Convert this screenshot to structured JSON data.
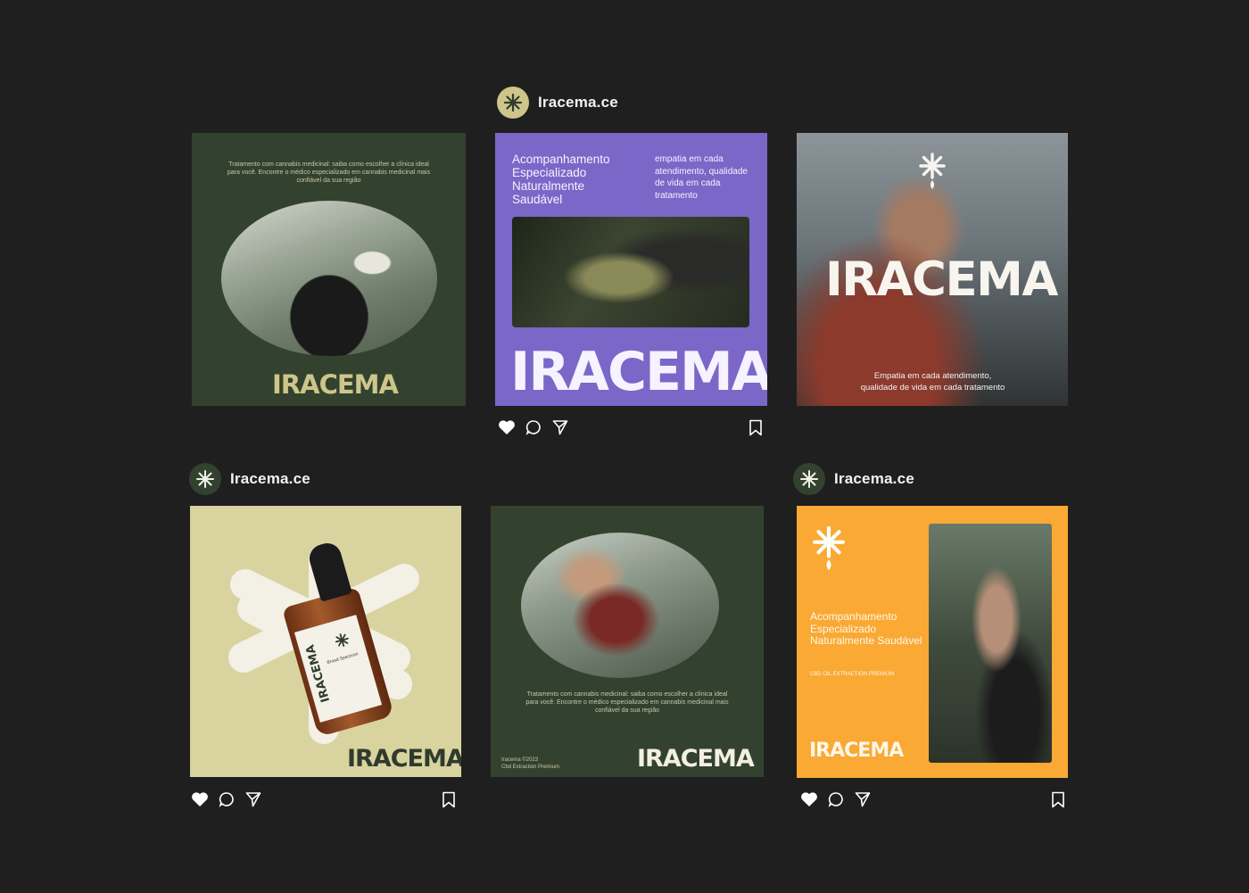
{
  "accounts": {
    "top": {
      "handle": "Iracema.ce"
    },
    "left": {
      "handle": "Iracema.ce"
    },
    "right": {
      "handle": "Iracema.ce"
    }
  },
  "posts": {
    "p1": {
      "caption": "Tratamento com cannabis medicinal: saiba como escolher a clínica ideal para você. Encontre o médico especializado em cannabis medicinal mais confiável da sua região",
      "wordmark": "IRACEMA"
    },
    "p2": {
      "heading": "Acompanhamento Especializado Naturalmente Saudável",
      "side_text": "empatia em  cada atendimento, qualidade de vida  em cada tratamento",
      "wordmark": "IRACEMA"
    },
    "p3": {
      "wordmark": "IRACEMA",
      "caption_line1": "Empatia em  cada atendimento,",
      "caption_line2": "qualidade de vida  em cada tratamento"
    },
    "p4": {
      "wordmark": "IRACEMA",
      "bottle_brand": "IRACEMA",
      "bottle_text": "Broad Spectrum"
    },
    "p5": {
      "caption": "Tratamento com cannabis medicinal: saiba como escolher a clínica ideal para você. Encontre o médico especializado em cannabis medicinal mais confiável da sua região",
      "footer_line1": "Iracema ©2023",
      "footer_line2": "Cbd Extraction Premium",
      "wordmark": "IRACEMA"
    },
    "p6": {
      "heading": "Acompanhamento Especializado Naturalmente Saudável",
      "subtitle": "CBD OIL EXTRACTION PREMIUM",
      "wordmark": "IRACEMA"
    }
  },
  "icons": [
    "cannabis-leaf-icon",
    "heart-icon",
    "comment-icon",
    "share-icon",
    "bookmark-icon",
    "asterisk-drop-icon"
  ],
  "colors": {
    "background": "#201f1f",
    "forest_green": "#33422f",
    "purple": "#7b67c8",
    "khaki": "#d9d3a0",
    "orange": "#f9a934",
    "gold_text": "#cdc58a"
  }
}
